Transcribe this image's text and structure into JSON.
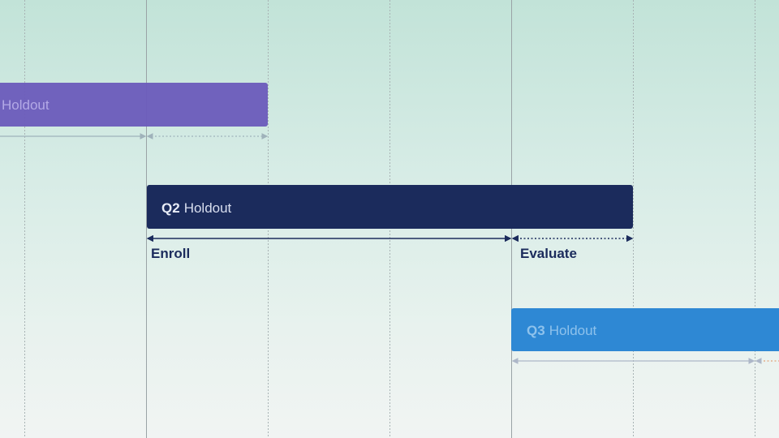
{
  "colors": {
    "q1": "#6a5bbb",
    "q2": "#1b2b5c",
    "q3": "#2e88d4",
    "grid_major": "#9aa3a6",
    "grid_minor": "#a8b3b4",
    "q1_arrow": "#9fb2ba",
    "q3_arrow": "#adb7c8",
    "q3_tail": "#e1a27a"
  },
  "bars": [
    {
      "id": "q1",
      "quarter": "",
      "name": "Holdout"
    },
    {
      "id": "q2",
      "quarter": "Q2",
      "name": "Holdout"
    },
    {
      "id": "q3",
      "quarter": "Q3",
      "name": "Holdout"
    }
  ],
  "phases": {
    "enroll": "Enroll",
    "evaluate": "Evaluate"
  }
}
